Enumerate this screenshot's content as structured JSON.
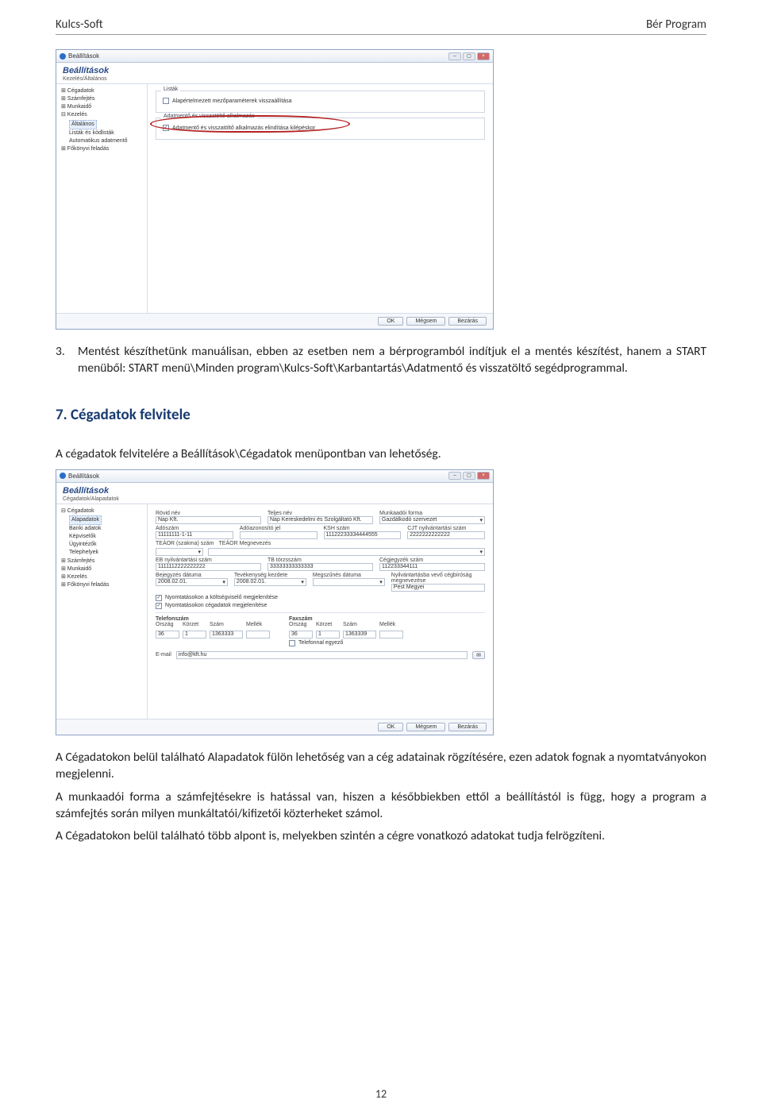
{
  "header": {
    "left": "Kulcs-Soft",
    "right": "Bér Program"
  },
  "page_number": "12",
  "list3": {
    "num": "3.",
    "text": "Mentést készíthetünk manuálisan, ebben az esetben nem a bérprogramból indítjuk el a mentés készítést, hanem a START menüből: START menü\\Minden program\\Kulcs-Soft\\Karbantartás\\Adatmentő és visszatöltő segédprogrammal."
  },
  "section7": {
    "title": "7. Cégadatok felvitele"
  },
  "para1": "A cégadatok felvitelére a Beállítások\\Cégadatok menüpontban van lehetőség.",
  "para2": "A Cégadatokon belül található Alapadatok fülön lehetőség van a cég adatainak rögzítésére, ezen adatok fognak a nyomtatványokon megjelenni.",
  "para3": "A munkaadói forma a számfejtésekre is hatással van, hiszen a későbbiekben ettől a beállítástól is függ, hogy a program a számfejtés során milyen munkáltatói/kifizetői közterheket számol.",
  "para4": "A Cégadatokon belül található több alpont is, melyekben szintén a cégre vonatkozó adatokat tudja felrögzíteni.",
  "ss_common": {
    "window_title": "Beállítások",
    "header_title": "Beállítások",
    "btn_ok": "OK",
    "btn_cancel": "Mégsem",
    "btn_help": "Bezárás"
  },
  "ss1": {
    "header_sub": "Kezelés/Általános",
    "tree": [
      {
        "t": "Cégadatok",
        "lvl": 0,
        "exp": "+"
      },
      {
        "t": "Számfejtés",
        "lvl": 0,
        "exp": "+"
      },
      {
        "t": "Munkaidő",
        "lvl": 0,
        "exp": "+"
      },
      {
        "t": "Kezelés",
        "lvl": 0,
        "exp": "-"
      },
      {
        "t": "Általános",
        "lvl": 1,
        "sel": true
      },
      {
        "t": "Listák és kódlisták",
        "lvl": 1
      },
      {
        "t": "Automatikus adatmentő",
        "lvl": 1
      },
      {
        "t": "Főkönyvi feladás",
        "lvl": 0,
        "exp": "+"
      }
    ],
    "group_label1": "Listák",
    "chk1": {
      "checked": false,
      "label": "Alapértelmezett mezőparaméterek visszaállítása"
    },
    "group_label2": "Adatmentő és visszatöltő alkalmazás",
    "chk2": {
      "checked": true,
      "label": "Adatmentő és visszatöltő alkalmazás elindítása kilépéskor"
    }
  },
  "ss2": {
    "header_sub": "Cégadatok/Alapadatok",
    "tree": [
      {
        "t": "Cégadatok",
        "lvl": 0,
        "exp": "-"
      },
      {
        "t": "Alapadatok",
        "lvl": 1,
        "sel": true
      },
      {
        "t": "Banki adatok",
        "lvl": 1
      },
      {
        "t": "Képviselők",
        "lvl": 1
      },
      {
        "t": "Ügyintézők",
        "lvl": 1
      },
      {
        "t": "Telephelyek",
        "lvl": 1
      },
      {
        "t": "Számfejtés",
        "lvl": 0,
        "exp": "+"
      },
      {
        "t": "Munkaidő",
        "lvl": 0,
        "exp": "+"
      },
      {
        "t": "Kezelés",
        "lvl": 0,
        "exp": "+"
      },
      {
        "t": "Főkönyvi feladás",
        "lvl": 0,
        "exp": "+"
      }
    ],
    "labels": {
      "rovid_nev": "Rövid név",
      "teljes_nev": "Teljes név",
      "munkaado": "Munkaadói forma",
      "adoszam": "Adószám",
      "ado_jel": "Adóazonosító jel",
      "ksh": "KSH szám",
      "cj_nyilv": "CJT nyilvántartási szám",
      "teaor_lbl": "TEÁOR (szakma) szám",
      "teaor_name": "TEÁOR Megnevezés",
      "eb_nyilv": "EB nyilvántartási szám",
      "tb_torzs": "TB törzsszám",
      "cegjegyzek": "Cégjegyzék szám",
      "bejegyzes": "Bejegyzés dátuma",
      "tevkezd": "Tevékenység kezdete",
      "megszunes": "Megszűnés dátuma",
      "nyilv_vevo": "Nyilvántartásba vevő cégbíróság megnevezése",
      "chk_nyomt1": "Nyomtatásokon a költségviselő megjelenítése",
      "chk_nyomt2": "Nyomtatásokon cégadatok megjelenítése",
      "tel_group": "Telefonszám",
      "fax_group": "Faxszám",
      "orszag": "Ország",
      "korzet": "Körzet",
      "szam": "Szám",
      "mellek": "Mellék",
      "chk_telfax": "Telefonnal egyező",
      "email_lbl": "E-mail"
    },
    "values": {
      "rovid_nev": "Nap Kft.",
      "teljes_nev": "Nap Kereskedelmi és Szolgáltató Kft.",
      "munkaado": "Gazdálkodó szervezet",
      "adoszam": "11111111-1-11",
      "ksh": "11122233334444555",
      "cj_nyilv": "2222222222222",
      "eb_nyilv": "1111112222222222",
      "tb_torzs": "33333333333333",
      "cegjegyzek": "112233344111",
      "bejegyzes": "2008.02.01.",
      "tevkezd": "2008.02.01.",
      "nyilv_vevo": "Pest Megyei",
      "tel_orszag": "36",
      "tel_korzet": "1",
      "tel_szam": "1363333",
      "tel_mellek": "",
      "fax_orszag": "36",
      "fax_korzet": "1",
      "fax_szam": "1363339",
      "fax_mellek": "",
      "email": "info@kft.hu"
    }
  }
}
